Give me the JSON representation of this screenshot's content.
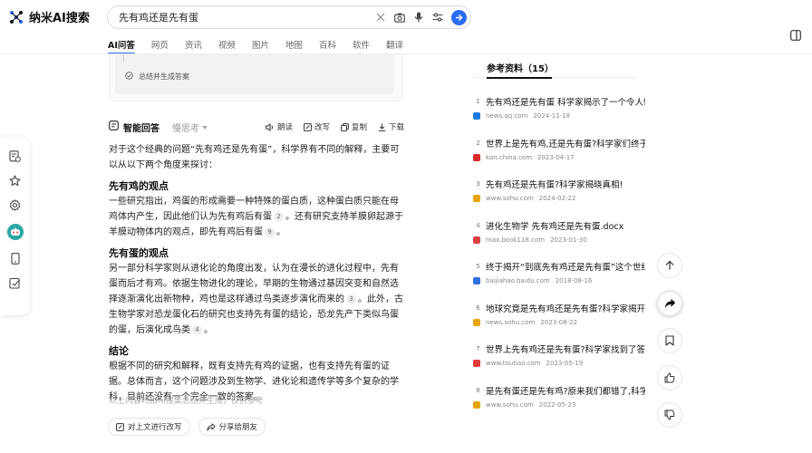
{
  "app": {
    "name": "纳米AI搜索"
  },
  "search": {
    "query": "先有鸡还是先有蛋"
  },
  "tabs": [
    {
      "label": "AI问答",
      "active": true
    },
    {
      "label": "网页"
    },
    {
      "label": "资讯"
    },
    {
      "label": "视频"
    },
    {
      "label": "图片"
    },
    {
      "label": "地图"
    },
    {
      "label": "百科"
    },
    {
      "label": "软件"
    },
    {
      "label": "翻译"
    }
  ],
  "steps": {
    "final_step": "总结并生成答案"
  },
  "answer_toolbar": {
    "title": "智能回答",
    "mode": "慢思考",
    "actions": {
      "read": "朗读",
      "edit": "改写",
      "copy": "复制",
      "download": "下载"
    }
  },
  "answer": {
    "intro": "对于这个经典的问题“先有鸡还是先有蛋”，科学界有不同的解释，主要可以从以下两个角度来探讨：",
    "sec1_title": "先有鸡的观点",
    "sec1_part1": "一些研究指出，鸡蛋的形成需要一种特殊的蛋白质，这种蛋白质只能在母鸡体内产生，因此他们认为先有鸡后有蛋",
    "sec1_cite1": "2",
    "sec1_part2": "。还有研究支持羊膜卵起源于羊膜动物体内的观点，即先有鸡后有蛋",
    "sec1_cite2": "9",
    "sec1_end": "。",
    "sec2_title": "先有蛋的观点",
    "sec2_part1": "另一部分科学家则从进化论的角度出发，认为在漫长的进化过程中，先有蛋而后才有鸡。依据生物进化的理论，早期的生物通过基因突变和自然选择逐渐演化出新物种，鸡也是这样通过鸟类逐步演化而来的",
    "sec2_cite1": "3",
    "sec2_part2": "。此外，古生物学家对恐龙蛋化石的研究也支持先有蛋的结论，恐龙先产下类似鸟蛋的蛋，后演化成鸟类",
    "sec2_cite2": "4",
    "sec2_end": "。",
    "sec3_title": "结论",
    "sec3_text": "根据不同的研究和解释，既有支持先有鸡的证据，也有支持先有蛋的证据。总体而言，这个问题涉及到生物学、进化论和遗传学等多个复杂的学科，目前还没有一个完全一致的答案。",
    "disclaimer": "以上内容均由AI搜集总结并生成，仅供参考"
  },
  "followups": {
    "rewrite": "对上文进行改写",
    "share": "分享给朋友"
  },
  "references": {
    "title": "参考资料（15）",
    "items": [
      {
        "num": "1",
        "title": "先有鸡还是先有蛋 科学家揭示了一个令人惊讶的答案",
        "source": "news.qq.com",
        "date": "2024-11-18",
        "color": "#1e7be0"
      },
      {
        "num": "2",
        "title": "世界上是先有鸡,还是先有蛋?科学家们终于给出答案",
        "source": "kan.china.com",
        "date": "2023-04-17",
        "color": "#d92b2b"
      },
      {
        "num": "3",
        "title": "先有鸡还是先有蛋?科学家揭晓真相!",
        "source": "www.sohu.com",
        "date": "2024-02-22",
        "color": "#e5a50a"
      },
      {
        "num": "4",
        "title": "进化生物学 先有鸡还是先有蛋.docx",
        "source": "max.book118.com",
        "date": "2023-01-30",
        "color": "#d94040"
      },
      {
        "num": "5",
        "title": "终于揭开“到底先有鸡还是先有蛋”这个世纪难题",
        "source": "baijiahao.baidu.com",
        "date": "2018-08-16",
        "color": "#2f6fe0"
      },
      {
        "num": "6",
        "title": "地球究竟是先有鸡还是先有蛋?科学家揭开谜底",
        "source": "news.sohu.com",
        "date": "2023-08-22",
        "color": "#e5a50a"
      },
      {
        "num": "7",
        "title": "世界上先有鸡还是先有蛋?科学家找到了答案",
        "source": "www.toutiao.com",
        "date": "2023-05-19",
        "color": "#e03b3b"
      },
      {
        "num": "8",
        "title": "是先有蛋还是先有鸡?原来我们都错了,科学家这样说",
        "source": "www.sohu.com",
        "date": "2022-05-23",
        "color": "#e5a50a"
      }
    ]
  }
}
